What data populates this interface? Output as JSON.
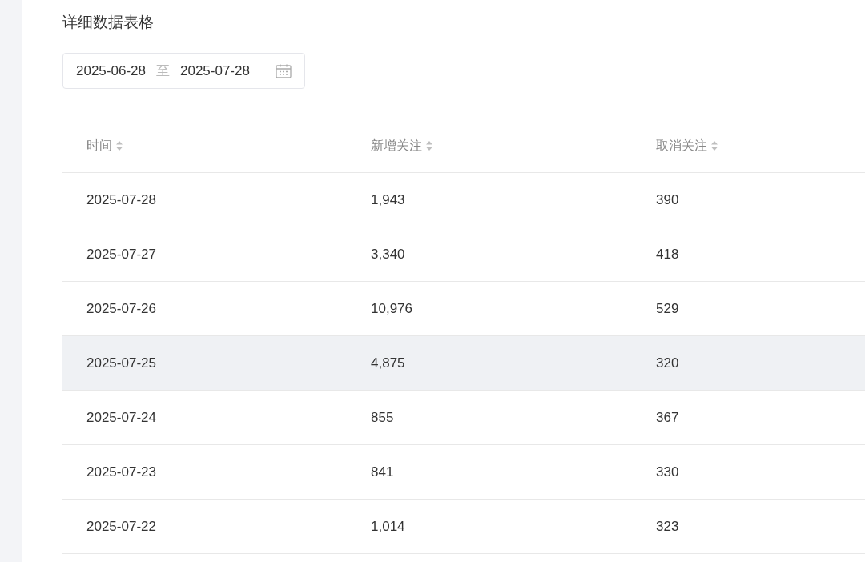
{
  "title": "详细数据表格",
  "date_range": {
    "start": "2025-06-28",
    "separator": "至",
    "end": "2025-07-28"
  },
  "table": {
    "columns": [
      "时间",
      "新增关注",
      "取消关注"
    ],
    "rows": [
      {
        "cells": [
          "2025-07-28",
          "1,943",
          "390"
        ],
        "highlighted": false
      },
      {
        "cells": [
          "2025-07-27",
          "3,340",
          "418"
        ],
        "highlighted": false
      },
      {
        "cells": [
          "2025-07-26",
          "10,976",
          "529"
        ],
        "highlighted": false
      },
      {
        "cells": [
          "2025-07-25",
          "4,875",
          "320"
        ],
        "highlighted": true
      },
      {
        "cells": [
          "2025-07-24",
          "855",
          "367"
        ],
        "highlighted": false
      },
      {
        "cells": [
          "2025-07-23",
          "841",
          "330"
        ],
        "highlighted": false
      },
      {
        "cells": [
          "2025-07-22",
          "1,014",
          "323"
        ],
        "highlighted": false
      }
    ]
  }
}
